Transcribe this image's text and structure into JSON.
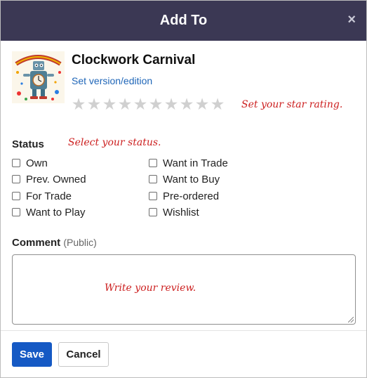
{
  "dialog": {
    "title": "Add To",
    "close_glyph": "×"
  },
  "game": {
    "name": "Clockwork Carnival",
    "version_link": "Set version/edition",
    "thumbnail_icon": "robot-clock-box-art-icon"
  },
  "rating": {
    "star_count": 10,
    "value": 0,
    "star_glyph": "★",
    "hint": "Set your star rating."
  },
  "status": {
    "label": "Status",
    "hint": "Select your status.",
    "options": [
      {
        "label": "Own",
        "checked": false
      },
      {
        "label": "Want in Trade",
        "checked": false
      },
      {
        "label": "Prev. Owned",
        "checked": false
      },
      {
        "label": "Want to Buy",
        "checked": false
      },
      {
        "label": "For Trade",
        "checked": false
      },
      {
        "label": "Pre-ordered",
        "checked": false
      },
      {
        "label": "Want to Play",
        "checked": false
      },
      {
        "label": "Wishlist",
        "checked": false
      }
    ]
  },
  "comment": {
    "label": "Comment",
    "visibility": "(Public)",
    "hint": "Write your review.",
    "value": ""
  },
  "footer": {
    "save_label": "Save",
    "cancel_label": "Cancel"
  },
  "colors": {
    "header_bg": "#3b3854",
    "primary": "#1559c4",
    "link": "#1f66b8",
    "hint": "#cc1f1f",
    "star_empty": "#d0d0d0"
  }
}
